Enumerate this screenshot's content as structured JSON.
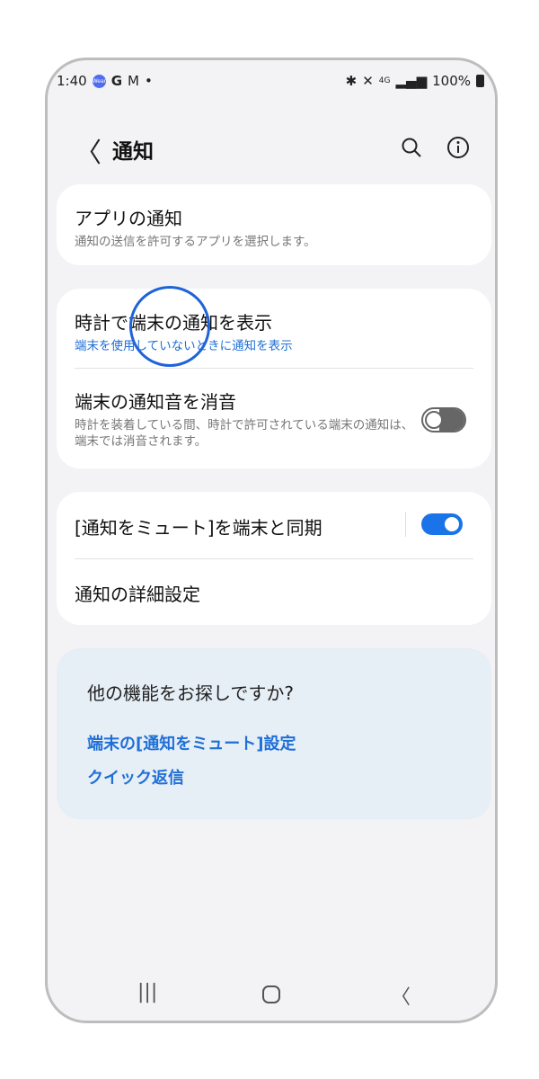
{
  "status_bar": {
    "time": "1:40",
    "wear_icon_text": "Wear",
    "battery": "100%",
    "network": "4G"
  },
  "header": {
    "title": "通知"
  },
  "card1": {
    "title": "アプリの通知",
    "subtitle": "通知の送信を許可するアプリを選択します。"
  },
  "card2": {
    "item1_title": "時計で端末の通知を表示",
    "item1_subtitle": "端末を使用していないときに通知を表示",
    "item2_title": "端末の通知音を消音",
    "item2_subtitle": "時計を装着している間、時計で許可されている端末の通知は、端末では消音されます。",
    "item2_toggle": false
  },
  "card3": {
    "item1_title": "[通知をミュート]を端末と同期",
    "item1_toggle": true,
    "item2_title": "通知の詳細設定"
  },
  "suggest": {
    "question": "他の機能をお探しですか?",
    "link1": "端末の[通知をミュート]設定",
    "link2": "クイック返信"
  },
  "colors": {
    "accent": "#1f6fd6",
    "background": "#f3f3f5"
  }
}
